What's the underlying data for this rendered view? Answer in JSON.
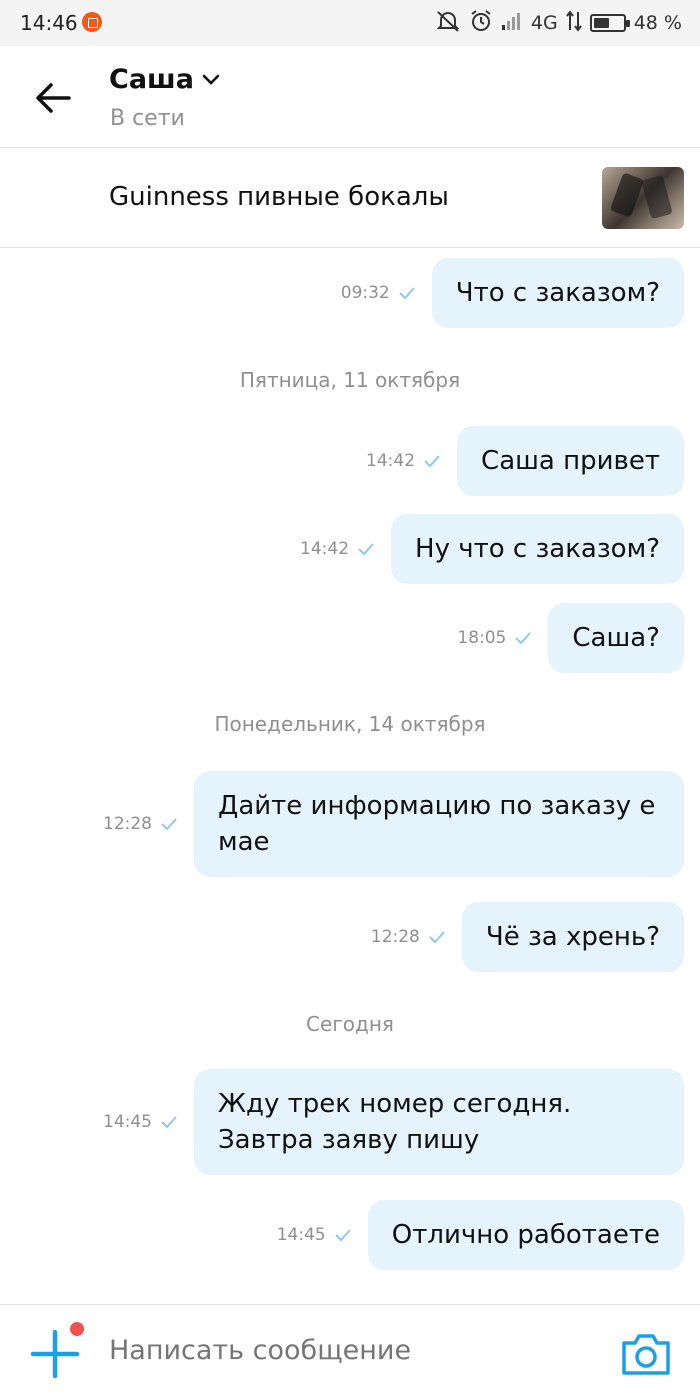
{
  "status_bar": {
    "time": "14:46",
    "network": "4G",
    "battery": "48 %",
    "battery_level": 0.48
  },
  "header": {
    "contact_name": "Саша",
    "contact_status": "В сети"
  },
  "product": {
    "title": "Guinness пивные бокалы"
  },
  "messages": [
    {
      "time": "09:32",
      "text": "Что с заказом?"
    },
    {
      "date": "Пятница, 11 октября"
    },
    {
      "time": "14:42",
      "text": "Саша привет"
    },
    {
      "time": "14:42",
      "text": "Ну что с заказом?"
    },
    {
      "time": "18:05",
      "text": "Саша?"
    },
    {
      "date": "Понедельник, 14 октября"
    },
    {
      "time": "12:28",
      "text": "Дайте информацию по заказу е мае"
    },
    {
      "time": "12:28",
      "text": "Чё за хрень?"
    },
    {
      "date": "Сегодня"
    },
    {
      "time": "14:45",
      "text": "Жду трек номер сегодня. Завтра заяву пишу"
    },
    {
      "time": "14:45",
      "text": "Отлично работаете"
    }
  ],
  "composer": {
    "placeholder": "Написать сообщение"
  },
  "colors": {
    "accent": "#1aa0e6",
    "bubble": "#e5f3fd",
    "check": "#8fc9ee",
    "notification_dot": "#f0524d"
  }
}
